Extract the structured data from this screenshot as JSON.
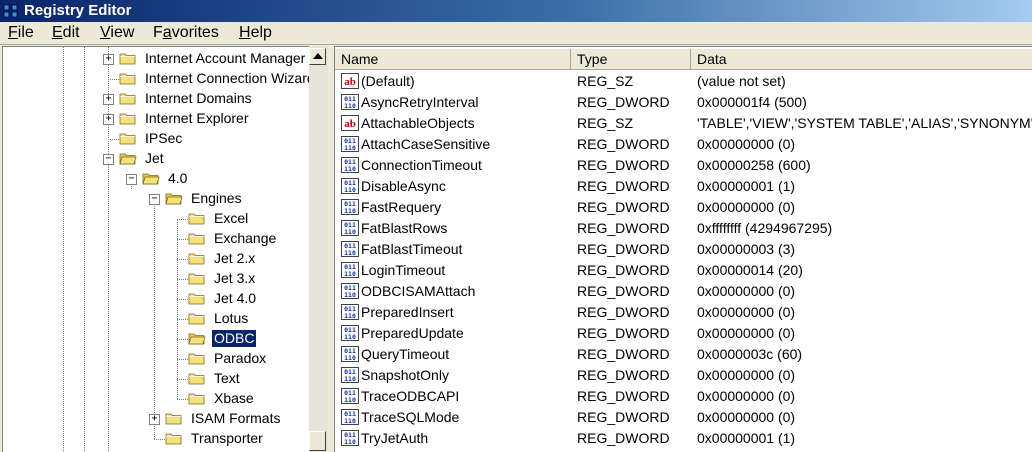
{
  "window": {
    "title": "Registry Editor"
  },
  "menu": [
    {
      "label": "File",
      "key": "F",
      "rest": "ile"
    },
    {
      "label": "Edit",
      "key": "E",
      "rest": "dit"
    },
    {
      "label": "View",
      "key": "V",
      "rest": "iew"
    },
    {
      "label": "Favorites",
      "key": "a",
      "pre": "F",
      "rest": "vorites"
    },
    {
      "label": "Help",
      "key": "H",
      "rest": "elp"
    }
  ],
  "tree": {
    "items": [
      {
        "label": "Internet Account Manager",
        "depth": 0,
        "expander": "plus"
      },
      {
        "label": "Internet Connection Wizard",
        "depth": 0,
        "expander": "none"
      },
      {
        "label": "Internet Domains",
        "depth": 0,
        "expander": "plus"
      },
      {
        "label": "Internet Explorer",
        "depth": 0,
        "expander": "plus"
      },
      {
        "label": "IPSec",
        "depth": 0,
        "expander": "none"
      },
      {
        "label": "Jet",
        "depth": 0,
        "expander": "minus"
      },
      {
        "label": "4.0",
        "depth": 1,
        "expander": "minus"
      },
      {
        "label": "Engines",
        "depth": 2,
        "expander": "minus"
      },
      {
        "label": "Excel",
        "depth": 3,
        "expander": "none"
      },
      {
        "label": "Exchange",
        "depth": 3,
        "expander": "none"
      },
      {
        "label": "Jet 2.x",
        "depth": 3,
        "expander": "none"
      },
      {
        "label": "Jet 3.x",
        "depth": 3,
        "expander": "none"
      },
      {
        "label": "Jet 4.0",
        "depth": 3,
        "expander": "none"
      },
      {
        "label": "Lotus",
        "depth": 3,
        "expander": "none"
      },
      {
        "label": "ODBC",
        "depth": 3,
        "expander": "none",
        "selected": true
      },
      {
        "label": "Paradox",
        "depth": 3,
        "expander": "none"
      },
      {
        "label": "Text",
        "depth": 3,
        "expander": "none"
      },
      {
        "label": "Xbase",
        "depth": 3,
        "expander": "none"
      },
      {
        "label": "ISAM Formats",
        "depth": 2,
        "expander": "plus"
      },
      {
        "label": "Transporter",
        "depth": 2,
        "expander": "none"
      }
    ]
  },
  "list": {
    "columns": {
      "name": "Name",
      "type": "Type",
      "data": "Data"
    },
    "rows": [
      {
        "name": "(Default)",
        "type": "REG_SZ",
        "data": "(value not set)",
        "icon": "string-value-icon"
      },
      {
        "name": "AsyncRetryInterval",
        "type": "REG_DWORD",
        "data": "0x000001f4 (500)",
        "icon": "binary-value-icon"
      },
      {
        "name": "AttachableObjects",
        "type": "REG_SZ",
        "data": "'TABLE','VIEW','SYSTEM TABLE','ALIAS','SYNONYM'",
        "icon": "string-value-icon"
      },
      {
        "name": "AttachCaseSensitive",
        "type": "REG_DWORD",
        "data": "0x00000000 (0)",
        "icon": "binary-value-icon"
      },
      {
        "name": "ConnectionTimeout",
        "type": "REG_DWORD",
        "data": "0x00000258 (600)",
        "icon": "binary-value-icon"
      },
      {
        "name": "DisableAsync",
        "type": "REG_DWORD",
        "data": "0x00000001 (1)",
        "icon": "binary-value-icon"
      },
      {
        "name": "FastRequery",
        "type": "REG_DWORD",
        "data": "0x00000000 (0)",
        "icon": "binary-value-icon"
      },
      {
        "name": "FatBlastRows",
        "type": "REG_DWORD",
        "data": "0xffffffff (4294967295)",
        "icon": "binary-value-icon"
      },
      {
        "name": "FatBlastTimeout",
        "type": "REG_DWORD",
        "data": "0x00000003 (3)",
        "icon": "binary-value-icon"
      },
      {
        "name": "LoginTimeout",
        "type": "REG_DWORD",
        "data": "0x00000014 (20)",
        "icon": "binary-value-icon"
      },
      {
        "name": "ODBCISAMAttach",
        "type": "REG_DWORD",
        "data": "0x00000000 (0)",
        "icon": "binary-value-icon"
      },
      {
        "name": "PreparedInsert",
        "type": "REG_DWORD",
        "data": "0x00000000 (0)",
        "icon": "binary-value-icon"
      },
      {
        "name": "PreparedUpdate",
        "type": "REG_DWORD",
        "data": "0x00000000 (0)",
        "icon": "binary-value-icon"
      },
      {
        "name": "QueryTimeout",
        "type": "REG_DWORD",
        "data": "0x0000003c (60)",
        "icon": "binary-value-icon"
      },
      {
        "name": "SnapshotOnly",
        "type": "REG_DWORD",
        "data": "0x00000000 (0)",
        "icon": "binary-value-icon"
      },
      {
        "name": "TraceODBCAPI",
        "type": "REG_DWORD",
        "data": "0x00000000 (0)",
        "icon": "binary-value-icon"
      },
      {
        "name": "TraceSQLMode",
        "type": "REG_DWORD",
        "data": "0x00000000 (0)",
        "icon": "binary-value-icon"
      },
      {
        "name": "TryJetAuth",
        "type": "REG_DWORD",
        "data": "0x00000001 (1)",
        "icon": "binary-value-icon"
      }
    ]
  },
  "colors": {
    "titlebar": "#0a246a",
    "selection": "#0a246a",
    "chrome": "#ece9d8",
    "folder": "#f6e27a"
  }
}
